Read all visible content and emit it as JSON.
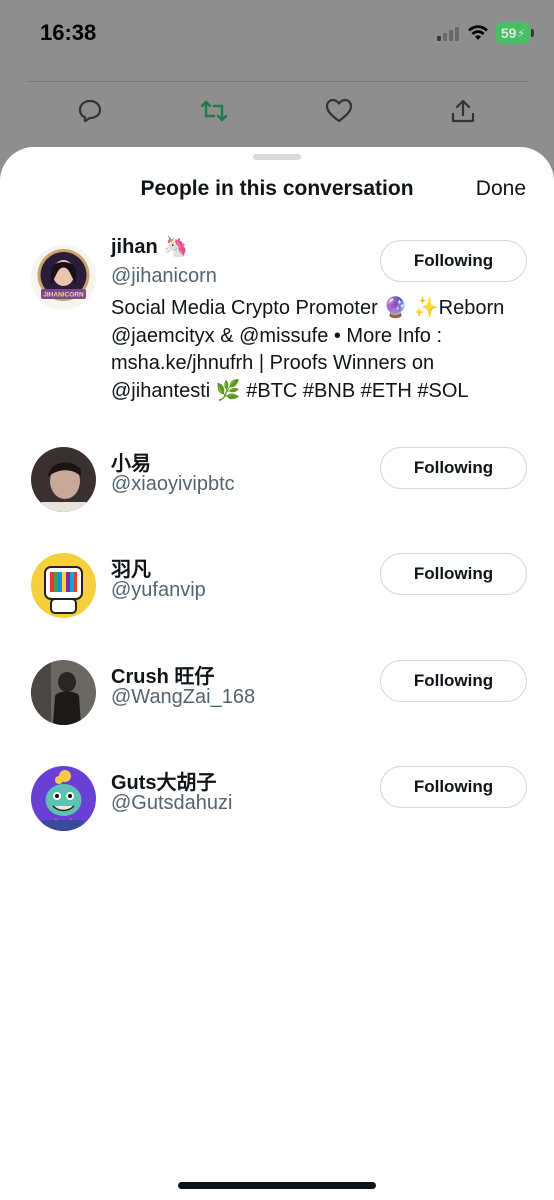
{
  "status_bar": {
    "time": "16:38",
    "battery": "59"
  },
  "background_actions": {
    "icons": [
      "reply-icon",
      "retweet-icon",
      "like-icon",
      "share-icon"
    ],
    "retweet_color": "#1f7a4d"
  },
  "sheet": {
    "title": "People in this conversation",
    "done_label": "Done"
  },
  "users": [
    {
      "name": "jihan 🦄",
      "handle": "@jihanicorn",
      "bio": "Social Media Crypto Promoter 🔮 ✨Reborn @jaemcityx & @missufe • More Info : msha.ke/jhnufrh | Proofs Winners on @jihantesti 🌿 #BTC #BNB #ETH #SOL",
      "button": "Following",
      "avatar_badge": "JIHANICORN"
    },
    {
      "name": "小易",
      "handle": "@xiaoyivipbtc",
      "button": "Following"
    },
    {
      "name": "羽凡",
      "handle": "@yufanvip",
      "button": "Following"
    },
    {
      "name": "Crush 旺仔",
      "handle": "@WangZai_168",
      "button": "Following"
    },
    {
      "name": "Guts大胡子",
      "handle": "@Gutsdahuzi",
      "button": "Following"
    }
  ],
  "colors": {
    "text_primary": "#0f1419",
    "text_secondary": "#536471",
    "border": "#cfd9de",
    "battery": "#30d158"
  }
}
